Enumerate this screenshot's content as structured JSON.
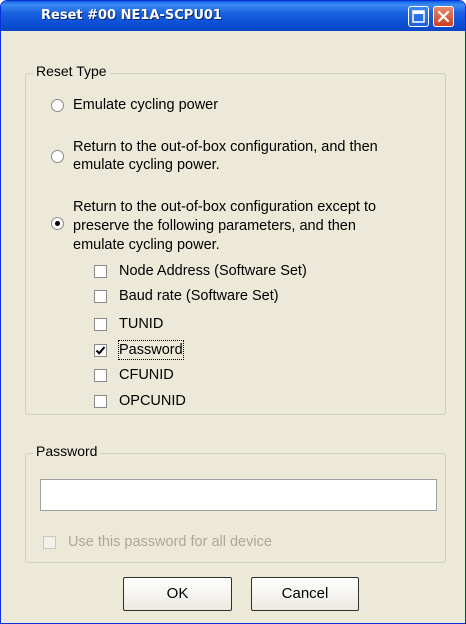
{
  "window": {
    "title": "Reset #00 NE1A-SCPU01",
    "maximize_icon": "maximize-icon",
    "close_icon": "close-icon"
  },
  "reset_type": {
    "legend": "Reset Type",
    "options": [
      {
        "label": "Emulate cycling power",
        "selected": false
      },
      {
        "label_lines": [
          "Return to the out-of-box configuration, and then",
          "emulate cycling power."
        ],
        "selected": false
      },
      {
        "label_lines": [
          "Return to the out-of-box configuration except to",
          "preserve the following parameters, and then",
          "emulate cycling power."
        ],
        "selected": true
      }
    ],
    "parameters": [
      {
        "label": "Node Address (Software Set)",
        "checked": false
      },
      {
        "label": "Baud rate (Software Set)",
        "checked": false
      },
      {
        "label": "TUNID",
        "checked": false
      },
      {
        "label": "Password",
        "checked": true
      },
      {
        "label": "CFUNID",
        "checked": false
      },
      {
        "label": "OPCUNID",
        "checked": false
      }
    ]
  },
  "password": {
    "legend": "Password",
    "value": "",
    "use_for_all_label": "Use this password for all device",
    "use_for_all_checked": false,
    "use_for_all_enabled": false
  },
  "buttons": {
    "ok": "OK",
    "cancel": "Cancel"
  }
}
